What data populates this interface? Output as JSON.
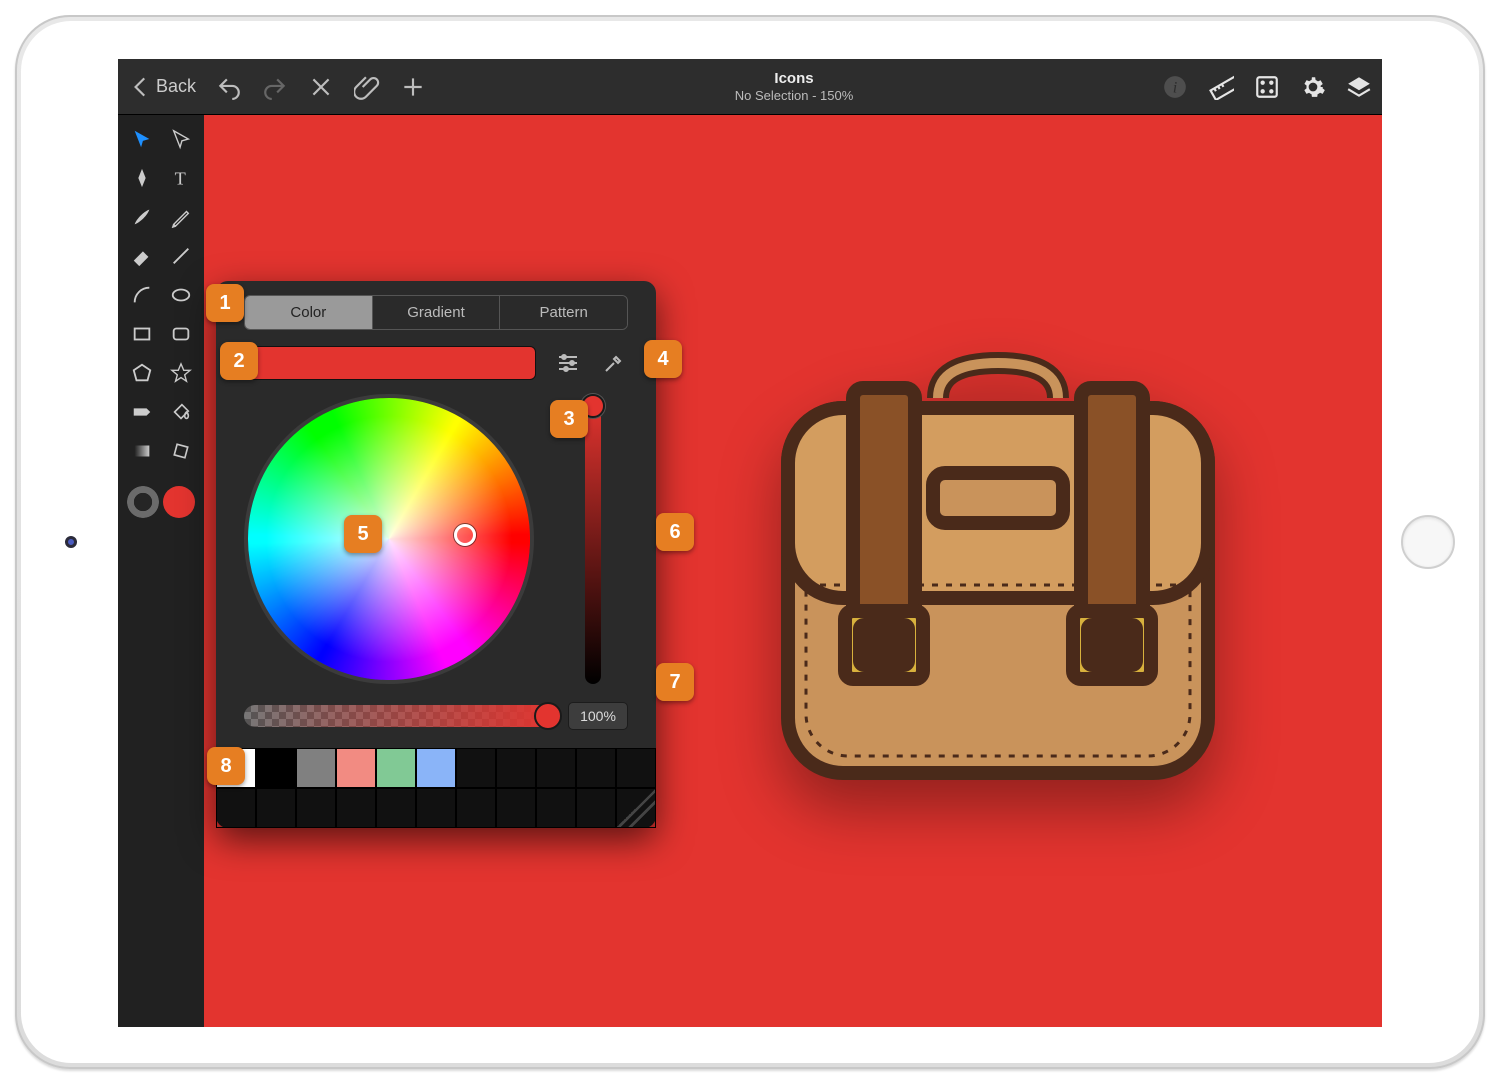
{
  "topbar": {
    "back": "Back",
    "title": "Icons",
    "subtitle": "No Selection - 150%"
  },
  "panel": {
    "tabs": {
      "color": "Color",
      "gradient": "Gradient",
      "pattern": "Pattern"
    },
    "current_color": "#e3342f",
    "opacity": "100%",
    "swatches": [
      "#ffffff",
      "#000000",
      "#808080",
      "#f28b82",
      "#81c995",
      "#8ab4f8"
    ]
  },
  "sidebar": {
    "stroke_color": "#666666",
    "fill_color": "#e3342f"
  },
  "callouts": [
    "1",
    "2",
    "3",
    "4",
    "5",
    "6",
    "7",
    "8"
  ]
}
